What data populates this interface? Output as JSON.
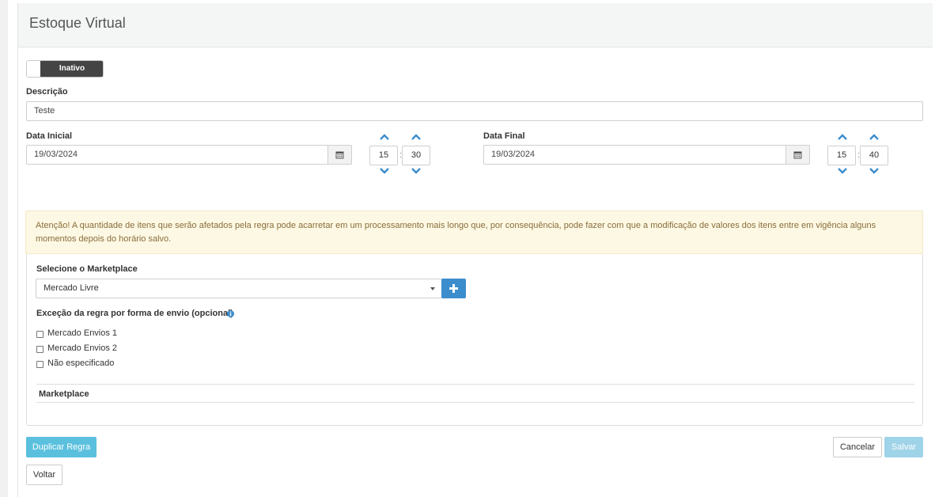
{
  "header": {
    "title": "Estoque Virtual"
  },
  "status_toggle": {
    "label": "Inativo",
    "state": "off"
  },
  "form": {
    "descricao": {
      "label": "Descrição",
      "value": "Teste"
    },
    "data_inicial": {
      "label": "Data Inicial",
      "date": "19/03/2024",
      "hour": "15",
      "minute": "30"
    },
    "data_final": {
      "label": "Data Final",
      "date": "19/03/2024",
      "hour": "15",
      "minute": "40"
    },
    "time_separator": ":"
  },
  "alert": {
    "text": "Atenção! A quantidade de itens que serão afetados pela regra pode acarretar em um processamento mais longo que, por consequência, pode fazer com que a modificação de valores dos itens entre em vigência alguns momentos depois do horário salvo."
  },
  "marketplace": {
    "select_label": "Selecione o Marketplace",
    "selected": "Mercado Livre",
    "exception_label": "Exceção da regra por forma de envio (opcional)",
    "shipping_options": [
      {
        "label": "Mercado Envios 1",
        "checked": false
      },
      {
        "label": "Mercado Envios 2",
        "checked": false
      },
      {
        "label": "Não especificado",
        "checked": false
      }
    ],
    "table_header": "Marketplace"
  },
  "actions": {
    "duplicate": "Duplicar Regra",
    "cancel": "Cancelar",
    "save": "Salvar",
    "back": "Voltar"
  },
  "colors": {
    "accent": "#3c8dcc",
    "info_button": "#5bc0de",
    "save_disabled": "#9fd3e8",
    "alert_bg": "#fcf8e3",
    "alert_text": "#8a6d3b",
    "toggle_dark": "#444444"
  }
}
